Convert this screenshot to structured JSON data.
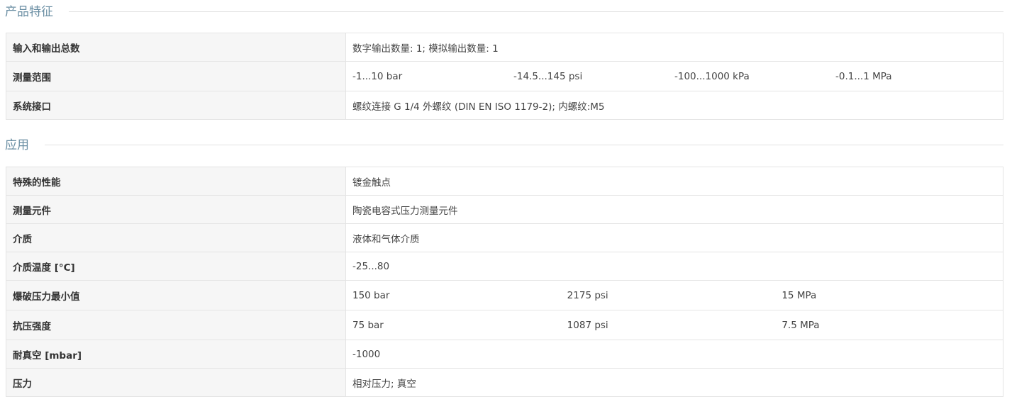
{
  "sections": [
    {
      "title": "产品特征",
      "rows": [
        {
          "label": "输入和输出总数",
          "value": "数字输出数量: 1; 模拟输出数量: 1"
        },
        {
          "label": "测量范围",
          "values": [
            "-1...10 bar",
            "-14.5...145 psi",
            "-100...1000 kPa",
            "-0.1...1 MPa"
          ]
        },
        {
          "label": "系统接口",
          "value": "螺纹连接 G 1/4 外螺纹 (DIN EN ISO 1179-2); 内螺纹:M5"
        }
      ]
    },
    {
      "title": "应用",
      "rows": [
        {
          "label": "特殊的性能",
          "value": "镀金触点"
        },
        {
          "label": "测量元件",
          "value": "陶瓷电容式压力测量元件"
        },
        {
          "label": "介质",
          "value": "液体和气体介质"
        },
        {
          "label": "介质温度 [°C]",
          "value": "-25...80"
        },
        {
          "label": "爆破压力最小值",
          "values": [
            "150 bar",
            "2175 psi",
            "15 MPa"
          ]
        },
        {
          "label": "抗压强度",
          "values": [
            "75 bar",
            "1087 psi",
            "7.5 MPa"
          ]
        },
        {
          "label": "耐真空 [mbar]",
          "value": "-1000"
        },
        {
          "label": "压力",
          "value": "相对压力; 真空"
        }
      ]
    }
  ]
}
